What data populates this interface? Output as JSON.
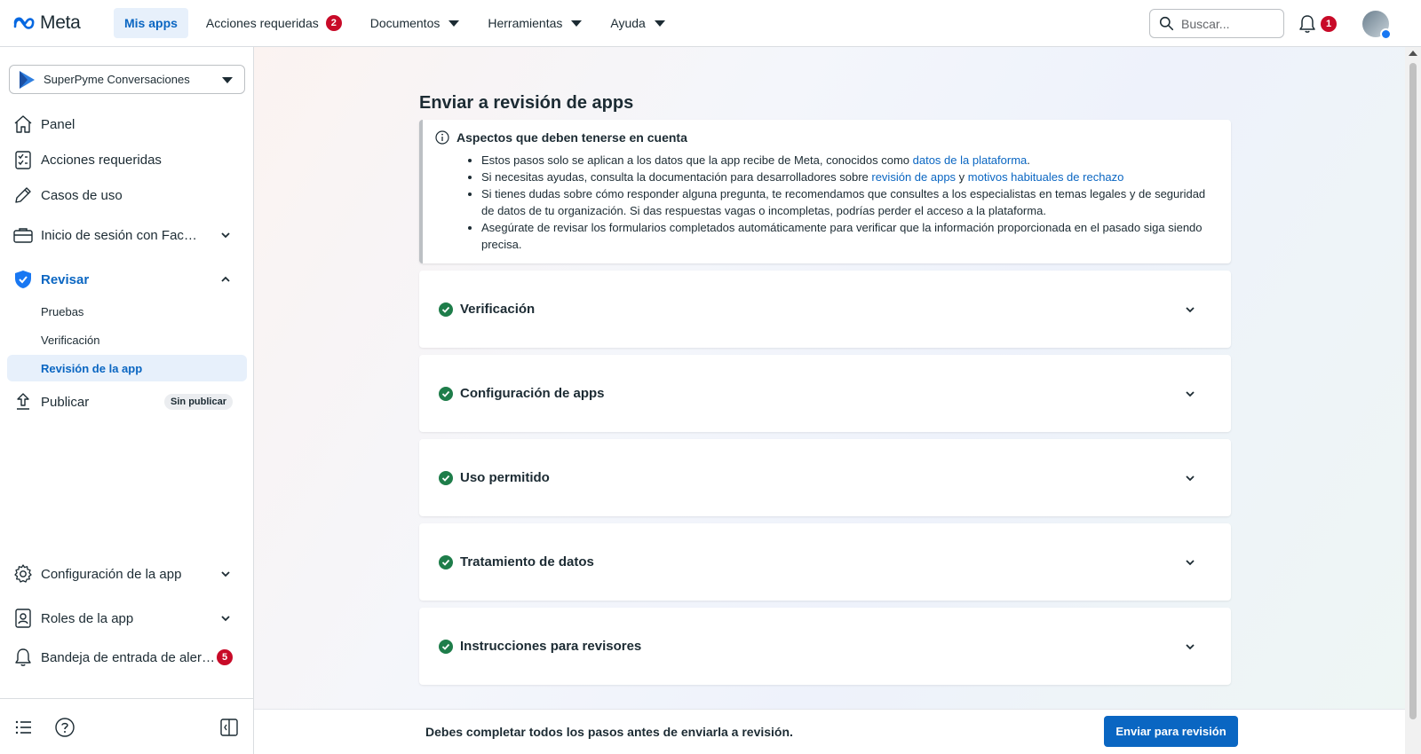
{
  "brand": {
    "logo_text": "Meta"
  },
  "topnav": {
    "items": [
      {
        "label": "Mis apps"
      },
      {
        "label": "Acciones requeridas",
        "badge": "2"
      },
      {
        "label": "Documentos"
      },
      {
        "label": "Herramientas"
      },
      {
        "label": "Ayuda"
      }
    ],
    "search_placeholder": "Buscar...",
    "notifications_badge": "1"
  },
  "sidebar": {
    "app_name": "SuperPyme Conversaciones",
    "items": [
      {
        "label": "Panel",
        "icon": "home-icon"
      },
      {
        "label": "Acciones requeridas",
        "icon": "checklist-icon"
      },
      {
        "label": "Casos de uso",
        "icon": "pencil-icon"
      },
      {
        "label": "Inicio de sesión con Facebook para empresas",
        "icon": "briefcase-icon"
      },
      {
        "label": "Revisar",
        "icon": "shield-check-icon"
      },
      {
        "label": "Publicar",
        "icon": "upload-icon",
        "pill": "Sin publicar"
      },
      {
        "label": "Configuración de la app",
        "icon": "gear-icon"
      },
      {
        "label": "Roles de la app",
        "icon": "person-badge-icon"
      },
      {
        "label": "Bandeja de entrada de alertas",
        "icon": "bell-icon",
        "badge": "5"
      }
    ],
    "review_subitems": [
      {
        "label": "Pruebas"
      },
      {
        "label": "Verificación"
      },
      {
        "label": "Revisión de la app"
      }
    ]
  },
  "main": {
    "title": "Enviar a revisión de apps",
    "notice": {
      "heading": "Aspectos que deben tenerse en cuenta",
      "b1_text": "Estos pasos solo se aplican a los datos que la app recibe de Meta, conocidos como ",
      "b1_link": "datos de la plataforma",
      "b1_end": ".",
      "b2_text": "Si necesitas ayudas, consulta la documentación para desarrolladores sobre ",
      "b2_link1": "revisión de apps",
      "b2_mid": " y ",
      "b2_link2": "motivos habituales de rechazo",
      "b3_text": "Si tienes dudas sobre cómo responder alguna pregunta, te recomendamos que consultes a los especialistas en temas legales y de seguridad de datos de tu organización. Si das respuestas vagas o incompletas, podrías perder el acceso a la plataforma.",
      "b4_text": "Asegúrate de revisar los formularios completados automáticamente para verificar que la información proporcionada en el pasado siga siendo precisa."
    },
    "sections": [
      {
        "title": "Verificación",
        "status": "complete"
      },
      {
        "title": "Configuración de apps",
        "status": "complete"
      },
      {
        "title": "Uso permitido",
        "status": "complete"
      },
      {
        "title": "Tratamiento de datos",
        "status": "complete"
      },
      {
        "title": "Instrucciones para revisores",
        "status": "complete"
      }
    ],
    "footer_message": "Debes completar todos los pasos antes de enviarla a revisión.",
    "submit_label": "Enviar para revisión"
  },
  "colors": {
    "accent": "#0a66c2",
    "badge": "#c80a28",
    "success": "#1e7d4a"
  }
}
